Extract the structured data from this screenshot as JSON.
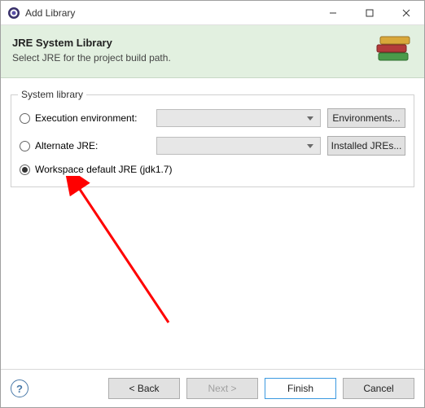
{
  "window": {
    "title": "Add Library"
  },
  "header": {
    "title": "JRE System Library",
    "description": "Select JRE for the project build path."
  },
  "group": {
    "label": "System library",
    "options": {
      "execution_env": "Execution environment:",
      "alternate_jre": "Alternate JRE:",
      "workspace_default": "Workspace default JRE (jdk1.7)"
    },
    "buttons": {
      "environments": "Environments...",
      "installed_jres": "Installed JREs..."
    }
  },
  "footer": {
    "back": "< Back",
    "next": "Next >",
    "finish": "Finish",
    "cancel": "Cancel"
  }
}
